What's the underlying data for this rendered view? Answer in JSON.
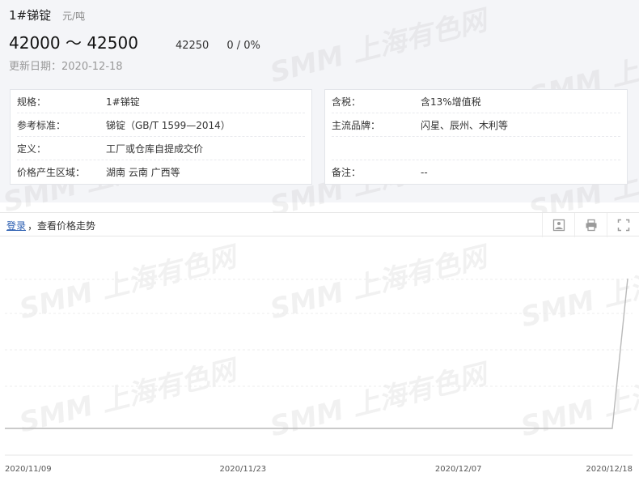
{
  "product": {
    "title": "1#锑锭",
    "unit": "元/吨",
    "range": "42000 ～ 42500",
    "average": "42250",
    "change": "0 / 0%",
    "update_date": "更新日期：2020-12-18"
  },
  "info_left": [
    {
      "label": "规格：",
      "value": "1#锑锭"
    },
    {
      "label": "参考标准：",
      "value": "锑锭（GB/T 1599—2014）"
    },
    {
      "label": "定义：",
      "value": "工厂或仓库自提成交价"
    },
    {
      "label": "价格产生区域：",
      "value": "湖南 云南 广西等"
    }
  ],
  "info_right": [
    {
      "label": "含税：",
      "value": "含13%增值税"
    },
    {
      "label": "主流品牌：",
      "value": "闪星、辰州、木利等"
    },
    {
      "label": "",
      "value": ""
    },
    {
      "label": "备注：",
      "value": "--"
    }
  ],
  "toolbar": {
    "login_label": "登录",
    "trend_text": "，查看价格走势",
    "icons": [
      "image-download-icon",
      "print-icon",
      "fullscreen-icon"
    ]
  },
  "watermark": "SMM 上海有色网",
  "chart_data": {
    "type": "line",
    "x_tick_labels": [
      "2020/11/09",
      "2020/11/23",
      "2020/12/07",
      "2020/12/18"
    ],
    "line_color": "#c8c8c8",
    "grid": true,
    "series": [
      {
        "x": [
          "2020/11/09",
          "2020/12/17",
          "2020/12/18"
        ],
        "values": [
          null,
          null,
          42250
        ]
      }
    ]
  }
}
